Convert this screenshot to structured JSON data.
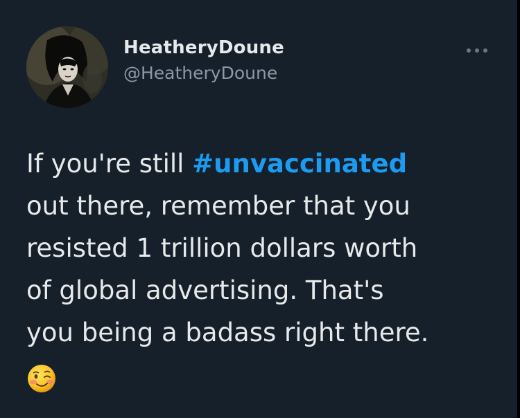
{
  "user": {
    "display_name": "HeatheryDoune",
    "handle": "@HeatheryDoune"
  },
  "more_icon": "more-horizontal-icon",
  "tweet": {
    "lines": [
      "If you're still ",
      "out there, remember that you",
      "resisted 1 trillion dollars worth",
      "of global advertising. That's",
      "you being a badass right there."
    ],
    "hashtag": "#unvaccinated",
    "emoji": "winking-face-icon"
  },
  "colors": {
    "background": "#15202b",
    "text": "#e7e9ea",
    "secondary_text": "#8b98a5",
    "link": "#1d9bf0"
  }
}
